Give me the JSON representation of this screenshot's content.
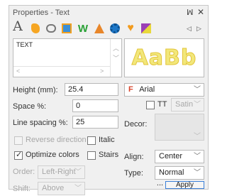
{
  "panel": {
    "title": "Properties - Text",
    "pin_glyph": "ꟽ",
    "close_glyph": "✕"
  },
  "toolbar": {
    "first_label": "A",
    "icons": [
      "text-icon",
      "fill-icon",
      "outline-icon",
      "picture-icon",
      "zigzag-icon",
      "arrow-icon",
      "gear-icon",
      "heart-icon",
      "palette-icon"
    ],
    "nav_prev": "◁",
    "nav_next": "▷"
  },
  "text_box": {
    "value": "TEXT",
    "scroll_up": "︿",
    "scroll_down": "﹀",
    "scroll_left": "<",
    "scroll_right": ">"
  },
  "preview": {
    "sample": "AaBb"
  },
  "height": {
    "label": "Height (mm):",
    "value": "25.4"
  },
  "space": {
    "label": "Space %:",
    "value": "0"
  },
  "line_spacing": {
    "label": "Line spacing %:",
    "value": "25"
  },
  "font": {
    "marker": "F",
    "value": "Arial",
    "chevron": "﹀"
  },
  "tt": {
    "label": "TT",
    "checked": false
  },
  "satin": {
    "value": "Satin",
    "chevron": "﹀"
  },
  "decor": {
    "label": "Decor:",
    "chevron": "﹀"
  },
  "reverse_direction": {
    "label": "Reverse direction",
    "checked": false,
    "disabled": true
  },
  "italic": {
    "label": "Italic",
    "checked": false
  },
  "optimize_colors": {
    "label": "Optimize colors",
    "checked": true
  },
  "stairs": {
    "label": "Stairs",
    "checked": false
  },
  "align": {
    "label": "Align:",
    "value": "Center",
    "chevron": "﹀"
  },
  "order": {
    "label": "Order:",
    "value": "Left-Right",
    "chevron": "﹀"
  },
  "type": {
    "label": "Type:",
    "value": "Normal",
    "chevron": "﹀"
  },
  "shift": {
    "label": "Shift:",
    "value": "Above",
    "chevron": "﹀"
  },
  "buttons": {
    "ellipsis": "...",
    "apply": "Apply"
  }
}
